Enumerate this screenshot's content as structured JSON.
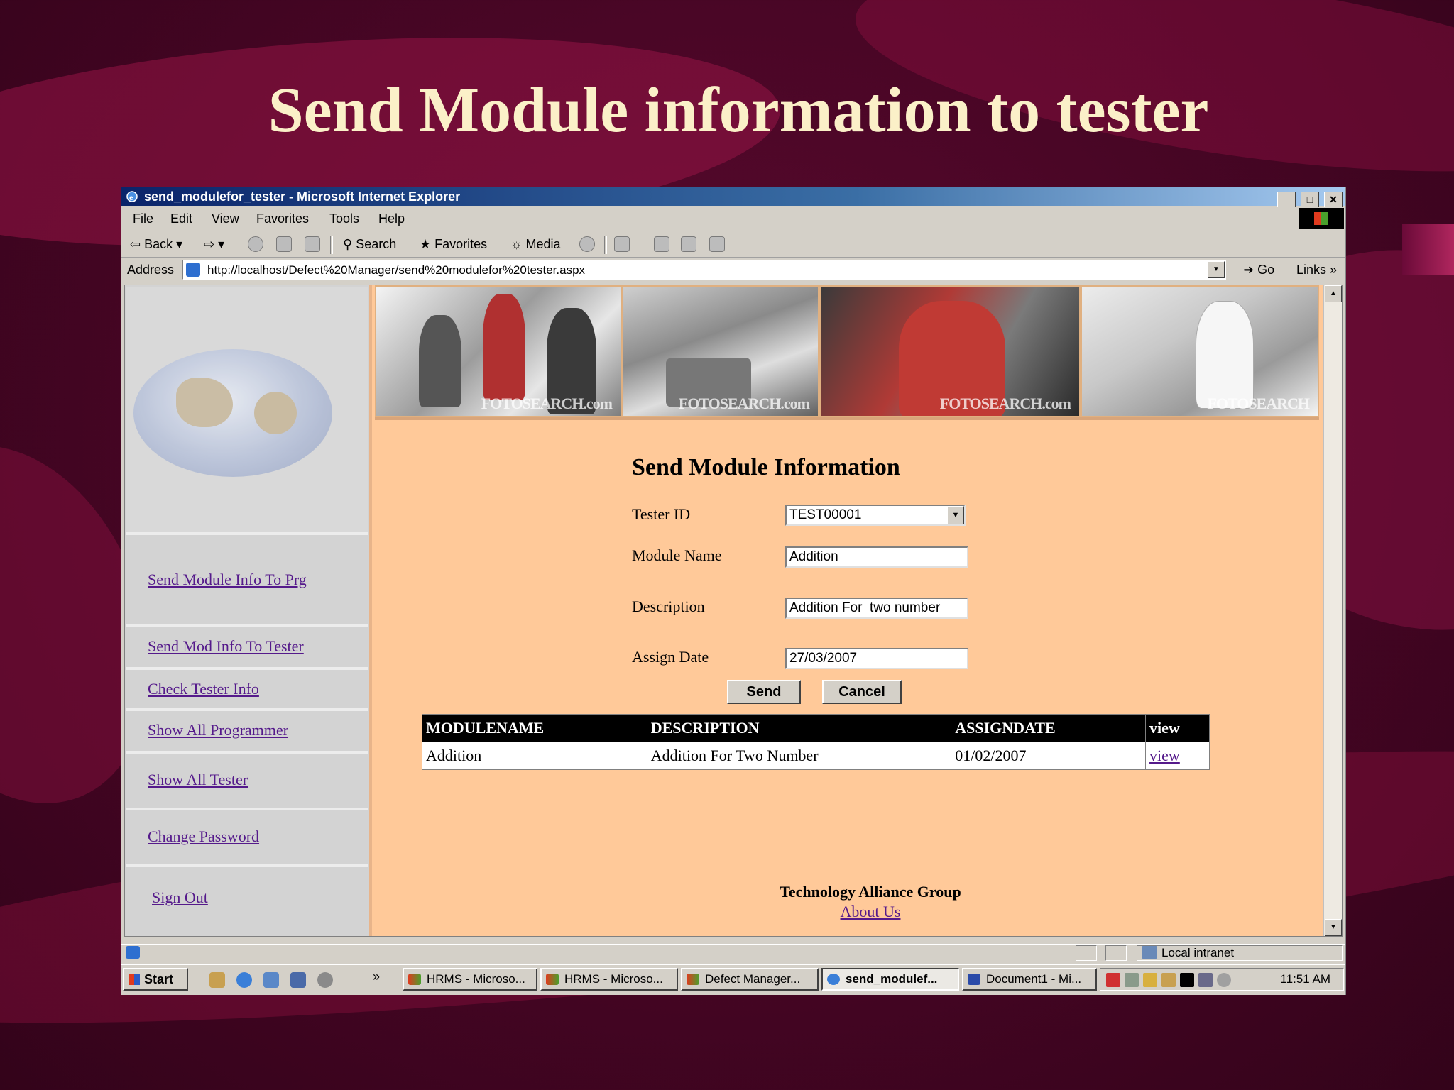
{
  "slide": {
    "title": "Send Module information to tester"
  },
  "window": {
    "title": "send_modulefor_tester - Microsoft Internet Explorer",
    "controls": [
      "_",
      "□",
      "✕"
    ]
  },
  "menu": [
    "File",
    "Edit",
    "View",
    "Favorites",
    "Tools",
    "Help"
  ],
  "toolbar": {
    "back": "Back",
    "search": "Search",
    "favorites": "Favorites",
    "media": "Media"
  },
  "address": {
    "label": "Address",
    "url": "http://localhost/Defect%20Manager/send%20modulefor%20tester.aspx",
    "go": "Go",
    "links": "Links"
  },
  "banner": {
    "watermarks": [
      "FOTOSEARCH.com",
      "FOTOSEARCH.com",
      "FOTOSEARCH.com",
      "FOTOSEARCH"
    ]
  },
  "sidebar": {
    "items": [
      {
        "label": "Send Module Info To Prg"
      },
      {
        "label": "Send Mod Info To Tester"
      },
      {
        "label": "Check Tester Info"
      },
      {
        "label": "Show All Programmer"
      },
      {
        "label": "Show All Tester"
      },
      {
        "label": "Change Password"
      },
      {
        "label": "Sign Out"
      }
    ]
  },
  "form": {
    "title": "Send Module Information",
    "tester_id_label": "Tester ID",
    "tester_id_value": "TEST00001",
    "module_name_label": "Module Name",
    "module_name_value": "Addition",
    "description_label": "Description",
    "description_value": "Addition For  two number",
    "assign_date_label": "Assign Date",
    "assign_date_value": "27/03/2007",
    "send_label": "Send",
    "cancel_label": "Cancel"
  },
  "table": {
    "headers": [
      "MODULENAME",
      "DESCRIPTION",
      "ASSIGNDATE",
      "view"
    ],
    "rows": [
      {
        "module": "Addition",
        "description": "Addition For Two Number",
        "date": "01/02/2007",
        "link": "view"
      }
    ]
  },
  "footer": {
    "org": "Technology Alliance Group",
    "about": "About Us"
  },
  "statusbar": {
    "zone": "Local intranet"
  },
  "taskbar": {
    "start": "Start",
    "overflow": "»",
    "tasks": [
      {
        "label": "HRMS - Microso..."
      },
      {
        "label": "HRMS - Microso..."
      },
      {
        "label": "Defect Manager..."
      },
      {
        "label": "send_modulef..."
      },
      {
        "label": "Document1 - Mi..."
      }
    ],
    "clock": "11:51 AM"
  }
}
